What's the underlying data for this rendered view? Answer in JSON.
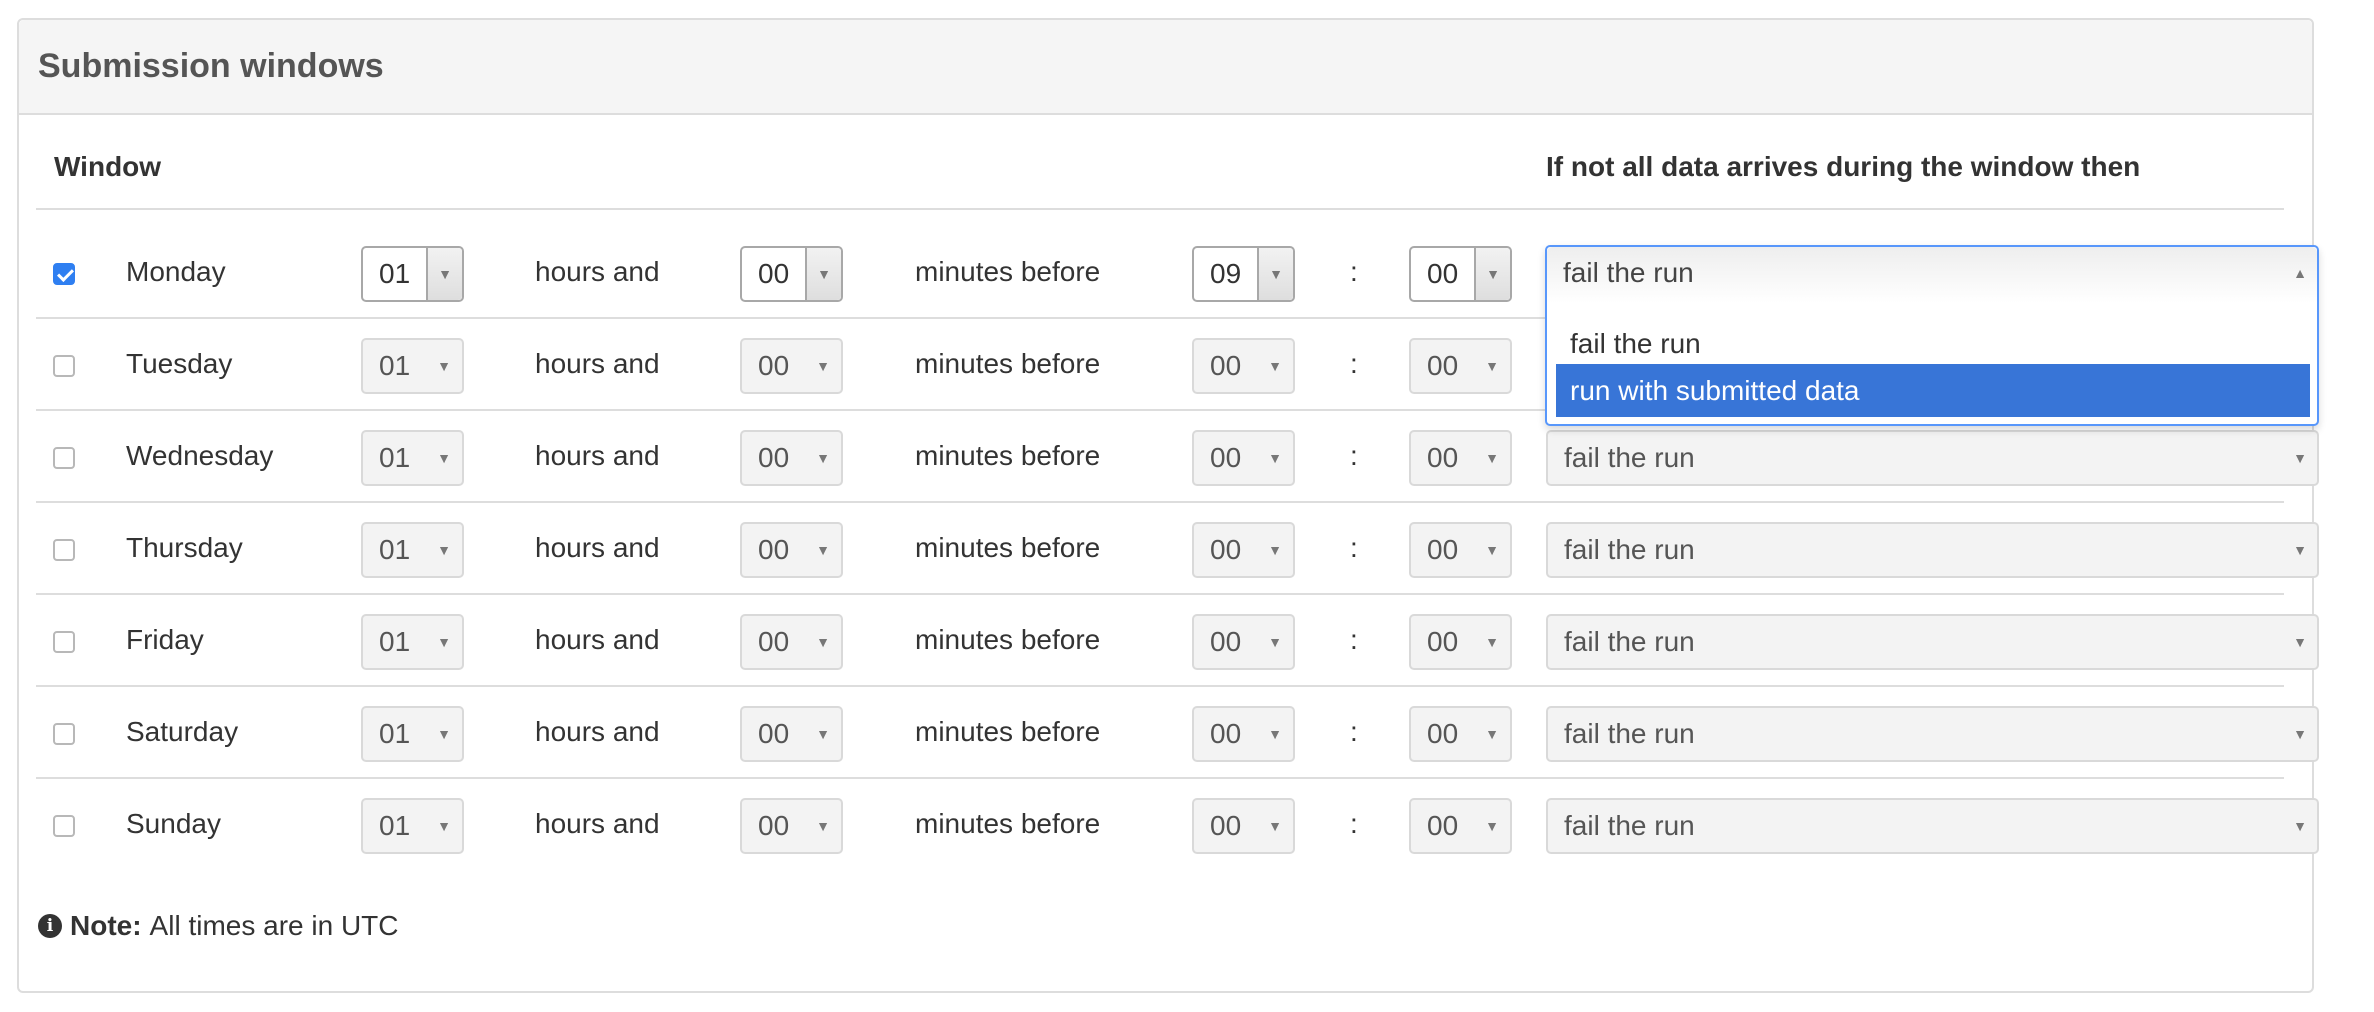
{
  "panel": {
    "title": "Submission windows"
  },
  "table": {
    "col_window": "Window",
    "col_action": "If not all data arrives during the window then"
  },
  "labels": {
    "hours_and": "hours and",
    "minutes_before": "minutes before",
    "colon": ":"
  },
  "rows": [
    {
      "day": "Monday",
      "checked": true,
      "hours": "01",
      "minutes": "00",
      "time_hour": "09",
      "time_min": "00",
      "action": "fail the run"
    },
    {
      "day": "Tuesday",
      "checked": false,
      "hours": "01",
      "minutes": "00",
      "time_hour": "00",
      "time_min": "00",
      "action": "fail the run"
    },
    {
      "day": "Wednesday",
      "checked": false,
      "hours": "01",
      "minutes": "00",
      "time_hour": "00",
      "time_min": "00",
      "action": "fail the run"
    },
    {
      "day": "Thursday",
      "checked": false,
      "hours": "01",
      "minutes": "00",
      "time_hour": "00",
      "time_min": "00",
      "action": "fail the run"
    },
    {
      "day": "Friday",
      "checked": false,
      "hours": "01",
      "minutes": "00",
      "time_hour": "00",
      "time_min": "00",
      "action": "fail the run"
    },
    {
      "day": "Saturday",
      "checked": false,
      "hours": "01",
      "minutes": "00",
      "time_hour": "00",
      "time_min": "00",
      "action": "fail the run"
    },
    {
      "day": "Sunday",
      "checked": false,
      "hours": "01",
      "minutes": "00",
      "time_hour": "00",
      "time_min": "00",
      "action": "fail the run"
    }
  ],
  "dropdown": {
    "current": "fail the run",
    "options": [
      "fail the run",
      "run with submitted data"
    ],
    "highlighted_index": 1
  },
  "note": {
    "icon": "info-icon",
    "icon_glyph": "i",
    "label": "Note:",
    "text": "All times are in UTC"
  },
  "colors": {
    "accent": "#3875d7",
    "checkbox": "#2f7ff1",
    "focus_border": "#5897fb"
  }
}
